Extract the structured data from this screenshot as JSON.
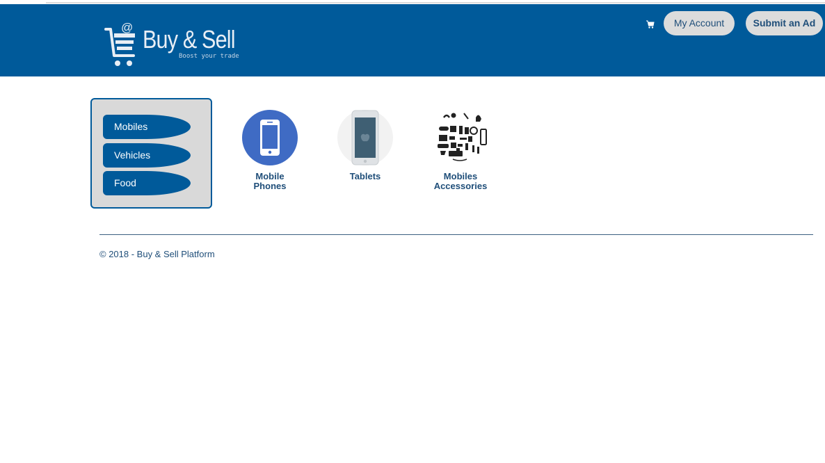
{
  "header": {
    "logo": {
      "title": "Buy & Sell",
      "tagline": "Boost your trade"
    },
    "cart_icon": "shopping-cart-icon",
    "my_account_label": "My Account",
    "submit_ad_label": "Submit an Ad",
    "background_color": "#005a9a"
  },
  "sidebar": {
    "items": [
      {
        "label": "Mobiles"
      },
      {
        "label": "Vehicles"
      },
      {
        "label": "Food"
      }
    ]
  },
  "categories": [
    {
      "label_line1": "Mobile",
      "label_line2": "Phones",
      "icon": "mobile-phone-icon"
    },
    {
      "label_line1": "Tablets",
      "label_line2": "",
      "icon": "tablet-icon"
    },
    {
      "label_line1": "Mobiles",
      "label_line2": "Accessories",
      "icon": "accessories-icon"
    }
  ],
  "footer": {
    "text": "© 2018 - Buy & Sell Platform"
  }
}
